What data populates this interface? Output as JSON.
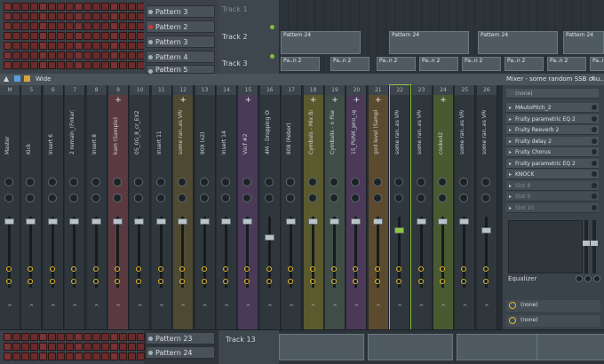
{
  "patterns_top": [
    {
      "label": "Pattern 3",
      "active": false
    },
    {
      "label": "Pattern 2",
      "active": true
    },
    {
      "label": "Pattern 3",
      "active": false
    },
    {
      "label": "Pattern 4",
      "active": false
    },
    {
      "label": "Pattern 5",
      "active": false
    }
  ],
  "tracks_top": [
    "Track 2",
    "Track 3"
  ],
  "clip_labels": [
    "Pattern 24",
    "Pa..n 2"
  ],
  "mixer": {
    "title": "Wide",
    "panel_title": "Mixer - some random SSB chu..",
    "strip_numbers": [
      "M",
      "5",
      "6",
      "7",
      "8",
      "9",
      "10",
      "11",
      "12",
      "13",
      "14",
      "15",
      "16",
      "17",
      "18",
      "19",
      "20",
      "21",
      "22",
      "23",
      "24",
      "25",
      "26"
    ],
    "strip_names": [
      "Master",
      "Kick",
      "Insert 6",
      "2 remain_(Fnkar)",
      "Insert 8",
      "kam (Sample)",
      "05_0G_8_cr_EX2",
      "Insert 11",
      "some ran..es VRG0",
      "909 (x2)",
      "Insert 14",
      "Vocf #2",
      "4M - Dropping Off",
      "808 (Reber)",
      "Cymbals - Mix Bass",
      "Cymbalis - n Piano",
      "15_PUNK_pno_up",
      "god level (Sample)",
      "some ran..es VRG0",
      "some ran..es VRG0",
      "cooked2",
      "some ran..es VRG0",
      "some ran..es VRG0"
    ],
    "effects": [
      {
        "label": "MAutoPitch_2",
        "enabled": true
      },
      {
        "label": "Fruity parametric EQ 2",
        "enabled": true
      },
      {
        "label": "Fruity Reeverb 2",
        "enabled": true
      },
      {
        "label": "Fruity delay 2",
        "enabled": true
      },
      {
        "label": "Fruity Chorus",
        "enabled": true
      },
      {
        "label": "Fruity parametric EQ 2",
        "enabled": true
      },
      {
        "label": "KNOCK",
        "enabled": true
      },
      {
        "label": "Slot 8",
        "enabled": false
      },
      {
        "label": "Slot 9",
        "enabled": false
      },
      {
        "label": "Slot 10",
        "enabled": false
      }
    ],
    "input_none": "(none)",
    "equalizer_label": "Equalizer",
    "route1": "(none)",
    "route2": "(none)"
  },
  "patterns_bottom": [
    "Pattern 23",
    "Pattern 24"
  ],
  "track_bottom": "Track 13",
  "colors": {
    "strip_tints": [
      "#2f373d",
      "#2f373d",
      "#2f373d",
      "#2f373d",
      "#2f373d",
      "#5a3a40",
      "#2f373d",
      "#2f373d",
      "#4e4a32",
      "#2f373d",
      "#2f373d",
      "#4a3a58",
      "#2f373d",
      "#2f373d",
      "#5a5a2e",
      "#3f4d46",
      "#4a3a58",
      "#5b4a2e",
      "#2f373d",
      "#2f373d",
      "#4a5a30",
      "#2f373d",
      "#2f373d"
    ],
    "accent_green": "#8ec63f",
    "accent_yellow": "#e0b72a"
  }
}
